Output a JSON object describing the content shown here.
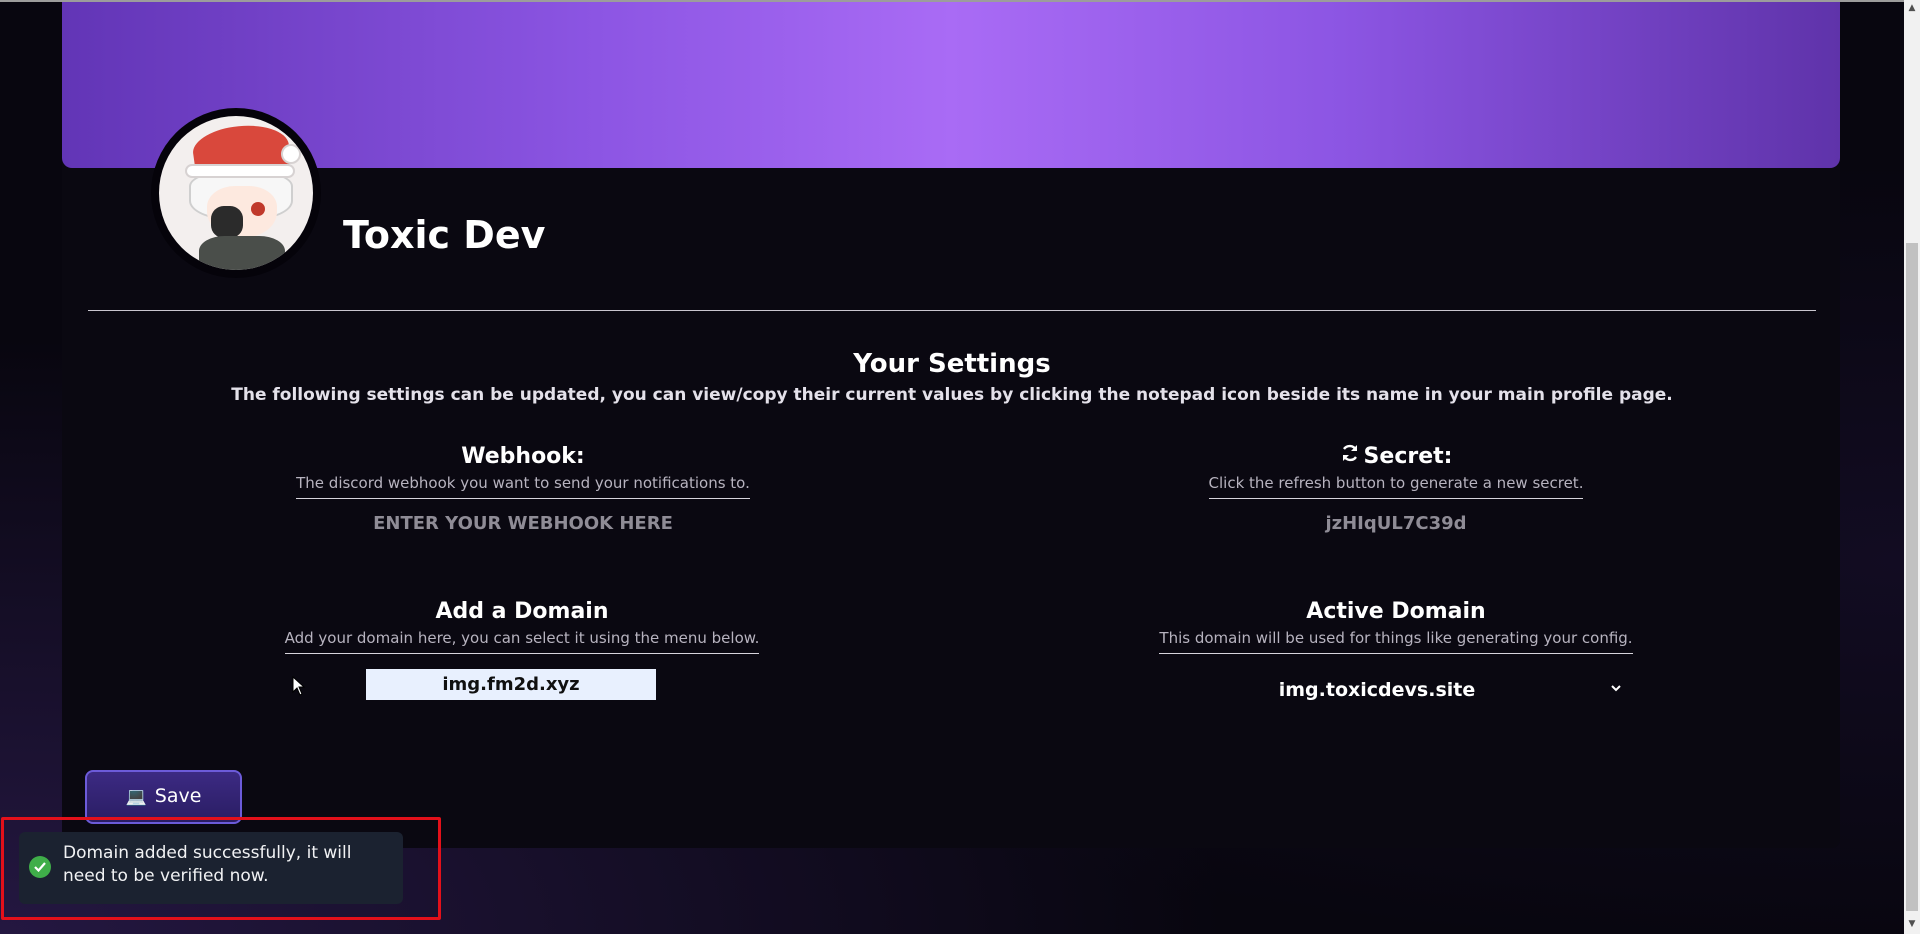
{
  "profile": {
    "name": "Toxic Dev"
  },
  "settings": {
    "title": "Your Settings",
    "description": "The following settings can be updated, you can view/copy their current values by clicking the notepad icon beside its name in your main profile page."
  },
  "webhook": {
    "label": "Webhook:",
    "help": "The discord webhook you want to send your notifications to.",
    "placeholder": "ENTER YOUR WEBHOOK HERE"
  },
  "secret": {
    "icon": "refresh-icon",
    "label": "Secret:",
    "help": "Click the refresh button to generate a new secret.",
    "value": "jzHIqUL7C39d"
  },
  "add_domain": {
    "label": "Add a Domain",
    "help": "Add your domain here, you can select it using the menu below.",
    "value": "img.fm2d.xyz"
  },
  "active_domain": {
    "label": "Active Domain",
    "help": "This domain will be used for things like generating your config.",
    "selected": "img.toxicdevs.site"
  },
  "save_button": {
    "icon": "laptop-icon",
    "label": "Save"
  },
  "toast": {
    "icon": "check-circle-icon",
    "message": "Domain added successfully, it will need to be verified now."
  },
  "colors": {
    "banner_start": "#6235b6",
    "banner_mid": "#a96bf5",
    "toast_bg": "#1b2230",
    "success": "#3fae49",
    "highlight": "#e3101a",
    "input_bg": "#e8f0fe"
  }
}
